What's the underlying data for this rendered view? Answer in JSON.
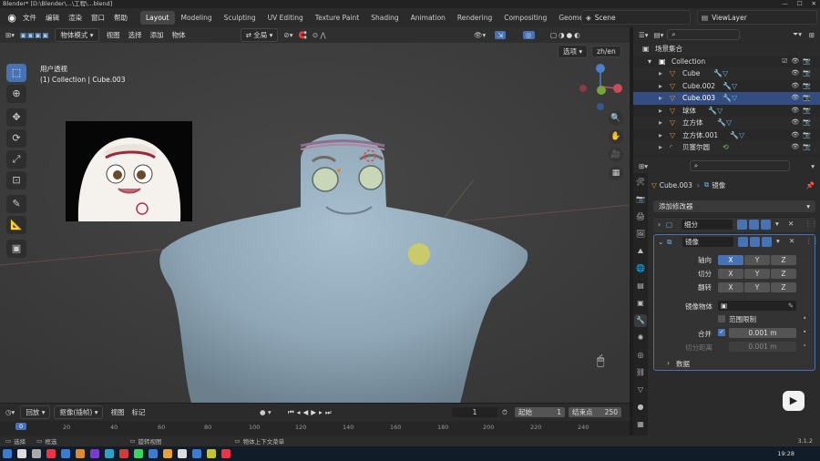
{
  "window": {
    "title": "Blender* [D:\\Blender\\...\\工程\\...blend]"
  },
  "menu": [
    "文件",
    "编辑",
    "渲染",
    "窗口",
    "帮助"
  ],
  "workspaces": [
    "Layout",
    "Modeling",
    "Sculpting",
    "UV Editing",
    "Texture Paint",
    "Shading",
    "Animation",
    "Rendering",
    "Compositing",
    "Geometr"
  ],
  "scene": {
    "label": "Scene"
  },
  "viewlayer": {
    "label": "ViewLayer"
  },
  "viewport_header": {
    "mode": "物体模式",
    "menus": [
      "视图",
      "选择",
      "添加",
      "物体"
    ],
    "transform": "全局",
    "options": "选项",
    "lang": "zh/en"
  },
  "viewport": {
    "view_name": "用户透视",
    "collection_info": "(1) Collection | Cube.003"
  },
  "timeline": {
    "menus": [
      "回放",
      "抠像(插帧)",
      "视图",
      "标记"
    ],
    "current_frame": "1",
    "start_label": "起始",
    "start": "1",
    "end_label": "结束点",
    "end": "250",
    "ticks": [
      "0",
      "20",
      "40",
      "60",
      "80",
      "100",
      "120",
      "140",
      "160",
      "180",
      "200",
      "220",
      "240"
    ]
  },
  "statusbar": {
    "select": "选择",
    "box_select": "框选",
    "rotate_view": "旋转视图",
    "context_menu": "物体上下文菜单",
    "version": "3.1.2"
  },
  "taskbar": {
    "time": "19:28"
  },
  "outliner": {
    "title": "场景集合",
    "items": [
      {
        "name": "Collection",
        "level": 0
      },
      {
        "name": "Cube",
        "level": 1
      },
      {
        "name": "Cube.002",
        "level": 1
      },
      {
        "name": "Cube.003",
        "level": 1,
        "selected": true
      },
      {
        "name": "球体",
        "level": 1
      },
      {
        "name": "立方体",
        "level": 1
      },
      {
        "name": "立方体.001",
        "level": 1
      },
      {
        "name": "贝塞尔圆",
        "level": 1
      }
    ]
  },
  "properties": {
    "object": "Cube.003",
    "modifier_context": "镜像",
    "add_modifier": "添加修改器",
    "modifiers": [
      {
        "name": "细分",
        "expanded": false
      },
      {
        "name": "镜像",
        "expanded": true
      }
    ],
    "mirror": {
      "axis_label": "轴向",
      "bisect_label": "切分",
      "flip_label": "翻转",
      "axes": [
        "X",
        "Y",
        "Z"
      ],
      "mirror_object_label": "镜像物体",
      "clipping_label": "范围限制",
      "merge_label": "合并",
      "merge_value": "0.001 m",
      "bisect_distance_label": "切分距离",
      "bisect_distance_value": "0.001 m",
      "data_label": "数据"
    }
  }
}
